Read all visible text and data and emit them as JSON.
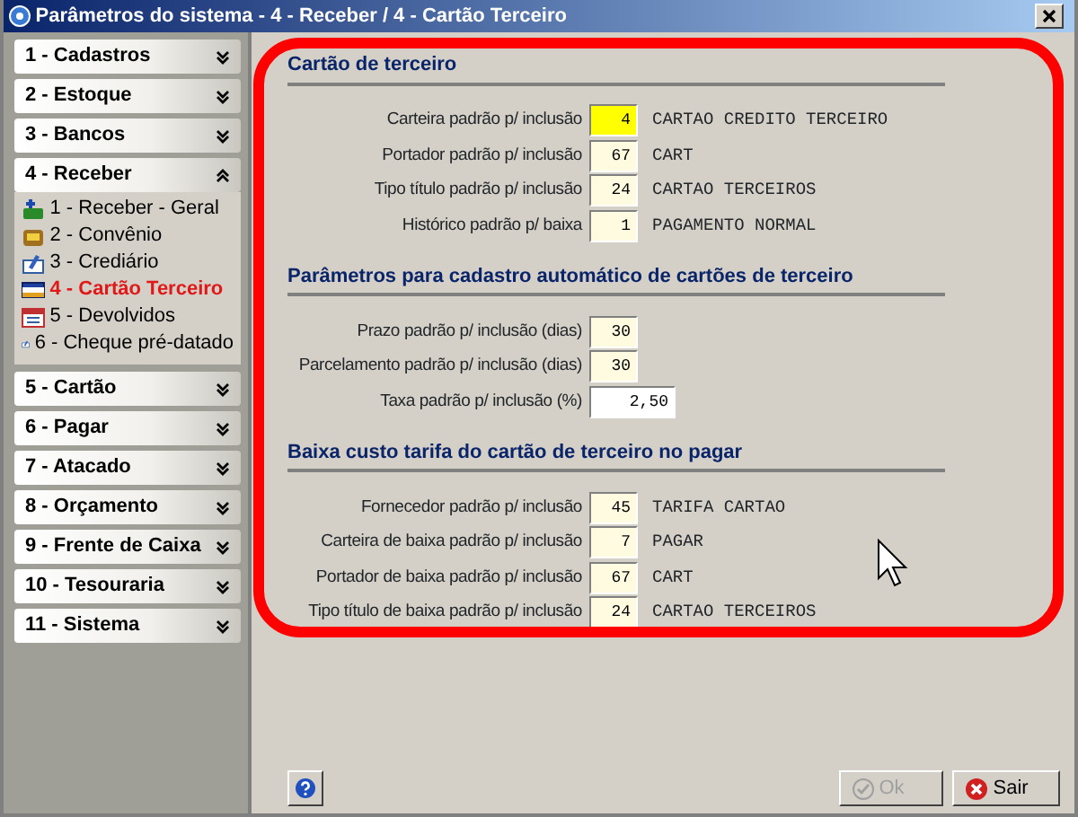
{
  "window": {
    "title": "Parâmetros do sistema - 4 - Receber / 4 - Cartão Terceiro"
  },
  "sidebar": {
    "groups": [
      {
        "label": "1 - Cadastros",
        "expanded": false
      },
      {
        "label": "2 - Estoque",
        "expanded": false
      },
      {
        "label": "3 - Bancos",
        "expanded": false
      },
      {
        "label": "4 - Receber",
        "expanded": true,
        "items": [
          {
            "label": "1 - Receber - Geral",
            "kind": "money",
            "selected": false
          },
          {
            "label": "2 - Convênio",
            "kind": "bag",
            "selected": false
          },
          {
            "label": "3 - Crediário",
            "kind": "document",
            "selected": false
          },
          {
            "label": "4 - Cartão Terceiro",
            "kind": "card",
            "selected": true
          },
          {
            "label": "5 - Devolvidos",
            "kind": "calendar",
            "selected": false
          },
          {
            "label": "6 - Cheque pré-datado",
            "kind": "document",
            "selected": false
          }
        ]
      },
      {
        "label": "5 - Cartão",
        "expanded": false
      },
      {
        "label": "6 - Pagar",
        "expanded": false
      },
      {
        "label": "7 - Atacado",
        "expanded": false
      },
      {
        "label": "8 - Orçamento",
        "expanded": false
      },
      {
        "label": "9 - Frente de Caixa",
        "expanded": false
      },
      {
        "label": "10 - Tesouraria",
        "expanded": false
      },
      {
        "label": "11 - Sistema",
        "expanded": false
      }
    ]
  },
  "sections": [
    {
      "title": "Cartão de terceiro",
      "fields": [
        {
          "label": "Carteira padrão p/ inclusão",
          "value": "4",
          "description": "CARTAO CREDITO TERCEIRO",
          "kind": "lookup",
          "focused": true
        },
        {
          "label": "Portador padrão p/ inclusão",
          "value": "67",
          "description": "CART",
          "kind": "lookup",
          "focused": false
        },
        {
          "label": "Tipo título padrão p/ inclusão",
          "value": "24",
          "description": "CARTAO TERCEIROS",
          "kind": "lookup",
          "focused": false
        },
        {
          "label": "Histórico padrão p/ baixa",
          "value": "1",
          "description": "PAGAMENTO NORMAL",
          "kind": "lookup",
          "focused": false
        }
      ]
    },
    {
      "title": "Parâmetros para cadastro automático de cartões de terceiro",
      "fields": [
        {
          "label": "Prazo padrão p/ inclusão (dias)",
          "value": "30",
          "kind": "number",
          "focused": false
        },
        {
          "label": "Parcelamento padrão p/ inclusão (dias)",
          "value": "30",
          "kind": "number",
          "focused": false
        },
        {
          "label": "Taxa padrão p/ inclusão (%)",
          "value": "2,50",
          "kind": "rate",
          "focused": false
        }
      ]
    },
    {
      "title": "Baixa custo tarifa do cartão de terceiro no pagar",
      "fields": [
        {
          "label": "Fornecedor padrão p/ inclusão",
          "value": "45",
          "description": "TARIFA CARTAO",
          "kind": "lookup",
          "focused": false
        },
        {
          "label": "Carteira de baixa padrão p/ inclusão",
          "value": "7",
          "description": "PAGAR",
          "kind": "lookup",
          "focused": false
        },
        {
          "label": "Portador de baixa padrão p/ inclusão",
          "value": "67",
          "description": "CART",
          "kind": "lookup",
          "focused": false
        },
        {
          "label": "Tipo título de baixa padrão p/ inclusão",
          "value": "24",
          "description": "CARTAO TERCEIROS",
          "kind": "lookup",
          "focused": false
        }
      ]
    }
  ],
  "buttons": [
    {
      "label": "Ok",
      "kind": "ok",
      "disabled": true
    },
    {
      "label": "Sair",
      "kind": "exit",
      "disabled": false
    }
  ],
  "annotation": {
    "kind": "rounded-outline"
  }
}
